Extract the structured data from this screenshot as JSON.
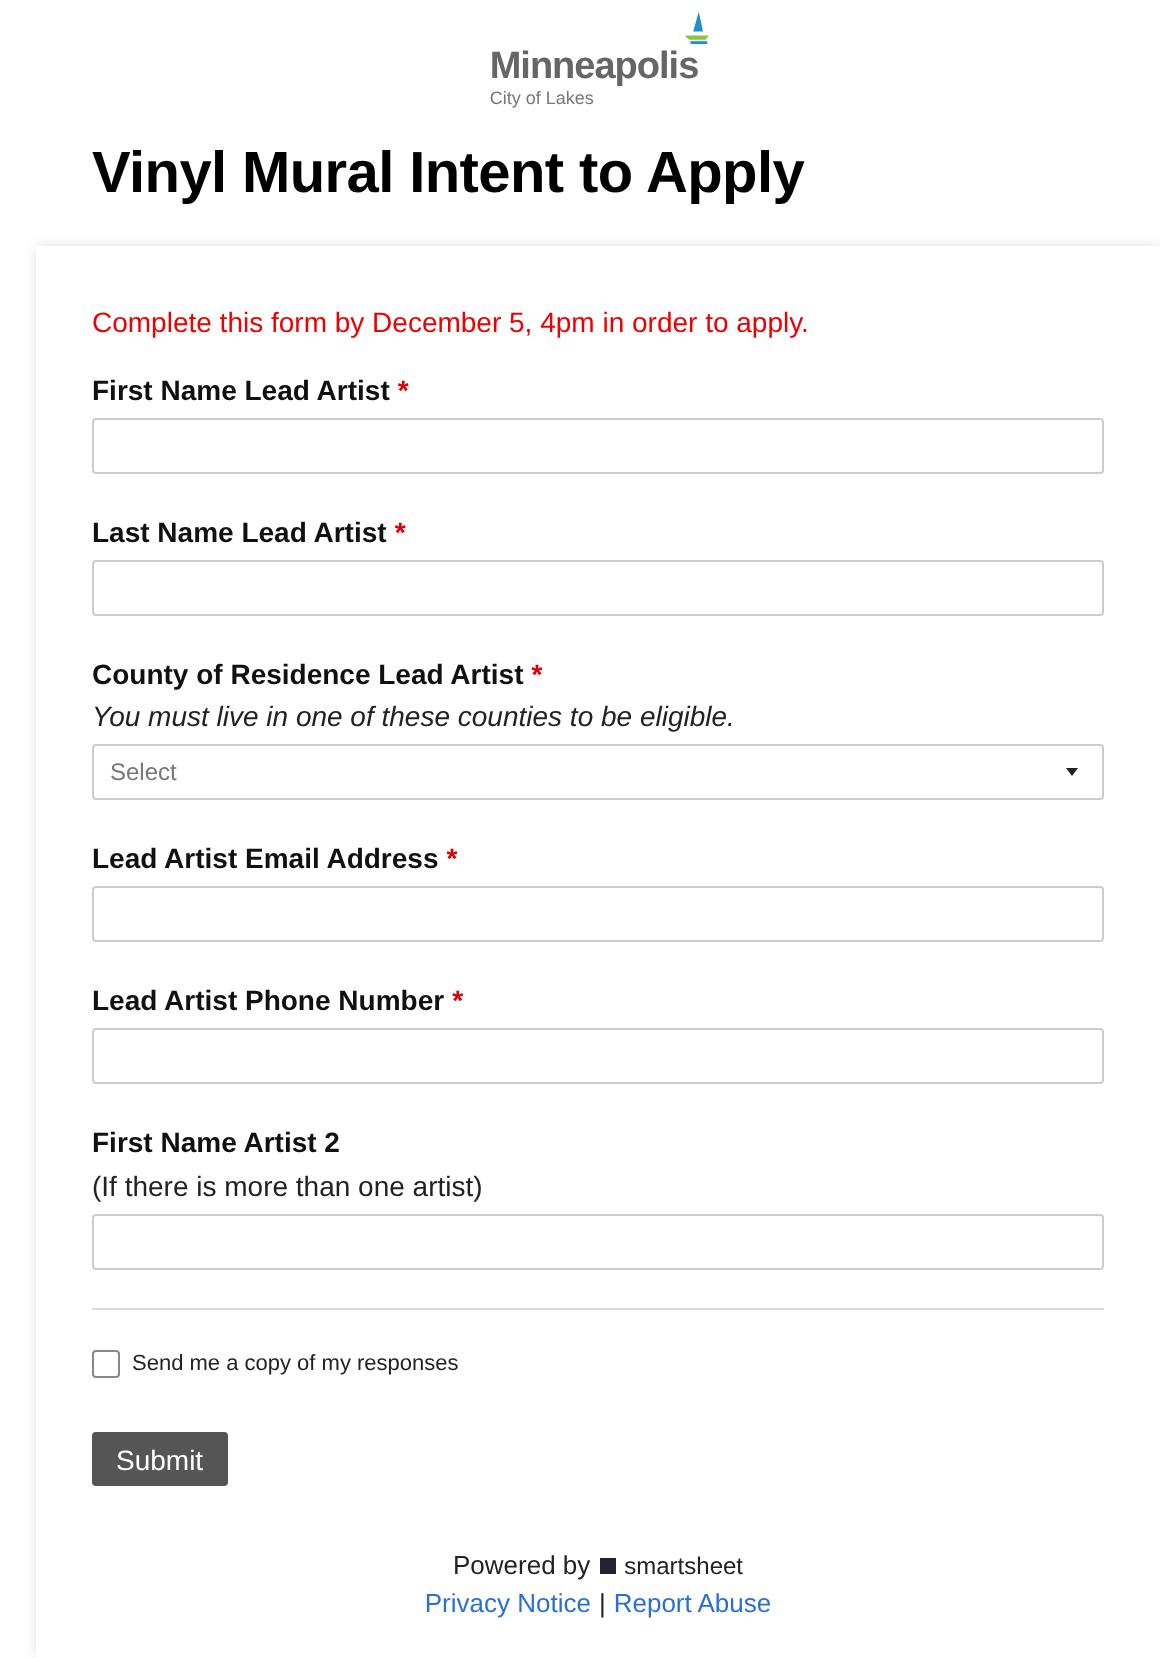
{
  "logo": {
    "name": "Minneapolis",
    "tagline": "City of Lakes"
  },
  "title": "Vinyl Mural Intent to Apply",
  "notice": "Complete this form by December 5, 4pm in order to apply.",
  "fields": [
    {
      "kind": "text",
      "label": "First Name Lead Artist",
      "required_mark": "*"
    },
    {
      "kind": "text",
      "label": "Last Name Lead Artist",
      "required_mark": "*"
    },
    {
      "kind": "select",
      "label": "County of Residence Lead Artist",
      "required_mark": "*",
      "hint": "You must live in one of these counties to be eligible.",
      "placeholder": "Select"
    },
    {
      "kind": "text",
      "label": "Lead Artist Email Address",
      "required_mark": "*"
    },
    {
      "kind": "text",
      "label": "Lead Artist Phone Number",
      "required_mark": "*"
    },
    {
      "kind": "text",
      "label": "First Name Artist 2",
      "note": "(If there is more than one artist)"
    }
  ],
  "copy_option": {
    "label": "Send me a copy of my responses",
    "checked": false
  },
  "submit": "Submit",
  "footer": {
    "powered_by": "Powered by",
    "brand": "smartsheet",
    "links": [
      "Privacy Notice",
      "Report Abuse"
    ],
    "separator": "|"
  }
}
